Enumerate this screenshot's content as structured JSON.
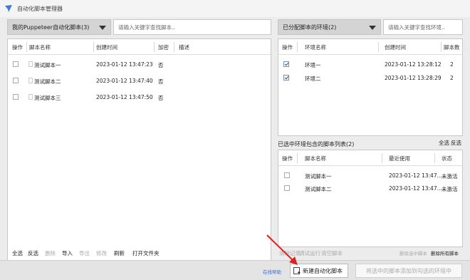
{
  "window": {
    "title": "自动化脚本管理器"
  },
  "left": {
    "dropdown": "我的Puppeteer自动化脚本(3)",
    "search_placeholder": "请输入关键字查找脚本..",
    "columns": [
      "操作",
      "脚本名称",
      "创建时间",
      "加密",
      "描述"
    ],
    "rows": [
      {
        "name": "测试脚本一",
        "created": "2023-01-12 13:47:23",
        "encrypted": "否"
      },
      {
        "name": "测试脚本二",
        "created": "2023-01-12 13:47:40",
        "encrypted": "否"
      },
      {
        "name": "测试脚本三",
        "created": "2023-01-12 13:47:50",
        "encrypted": "否"
      }
    ],
    "toolbar": [
      "全选",
      "反选",
      "删除",
      "导入",
      "导出",
      "修改",
      "刷新",
      "打开文件夹"
    ]
  },
  "right": {
    "dropdown": "已分配脚本的环境(2)",
    "search_placeholder": "请输入关键字查找环境..",
    "env_columns": [
      "操作",
      "环境名称",
      "创建时间",
      "脚本数"
    ],
    "env_rows": [
      {
        "name": "环境一",
        "created": "2023-01-12 13:28:12",
        "count": "2"
      },
      {
        "name": "环境二",
        "created": "2023-01-12 13:28:29",
        "count": "2"
      }
    ],
    "select_all": "全选",
    "invert": "反选",
    "sub_title": "已选中环境包含的脚本列表(2)",
    "script_columns": [
      "操作",
      "脚本名称",
      "最近使用",
      "状态"
    ],
    "script_rows": [
      {
        "name": "测试脚本一",
        "last_used": "2023-01-12 13:47...",
        "status": "未激活"
      },
      {
        "name": "测试脚本二",
        "last_used": "2023-01-12 13:47...",
        "status": "未激活"
      }
    ],
    "toolbar_disabled": [
      "清除记录",
      "调试运行",
      "清空脚本"
    ],
    "remove_selected": "删除选中脚本",
    "remove_all": "删除所有脚本"
  },
  "bottom": {
    "help": "在线帮助",
    "new_script": "新建自动化脚本",
    "add_to_env": "将选中的脚本添加到勾选的环境中"
  },
  "colors": {
    "link": "#3a6fd8",
    "annotation": "#e02020"
  }
}
